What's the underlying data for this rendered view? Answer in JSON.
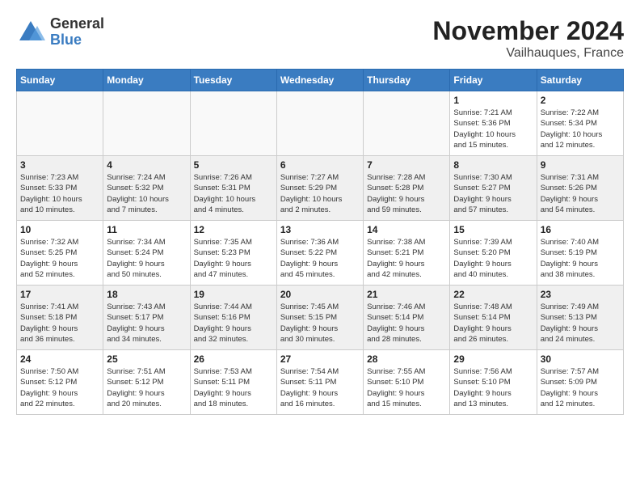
{
  "logo": {
    "general": "General",
    "blue": "Blue"
  },
  "title": "November 2024",
  "location": "Vailhauques, France",
  "headers": [
    "Sunday",
    "Monday",
    "Tuesday",
    "Wednesday",
    "Thursday",
    "Friday",
    "Saturday"
  ],
  "weeks": [
    [
      {
        "day": "",
        "info": ""
      },
      {
        "day": "",
        "info": ""
      },
      {
        "day": "",
        "info": ""
      },
      {
        "day": "",
        "info": ""
      },
      {
        "day": "",
        "info": ""
      },
      {
        "day": "1",
        "info": "Sunrise: 7:21 AM\nSunset: 5:36 PM\nDaylight: 10 hours\nand 15 minutes."
      },
      {
        "day": "2",
        "info": "Sunrise: 7:22 AM\nSunset: 5:34 PM\nDaylight: 10 hours\nand 12 minutes."
      }
    ],
    [
      {
        "day": "3",
        "info": "Sunrise: 7:23 AM\nSunset: 5:33 PM\nDaylight: 10 hours\nand 10 minutes."
      },
      {
        "day": "4",
        "info": "Sunrise: 7:24 AM\nSunset: 5:32 PM\nDaylight: 10 hours\nand 7 minutes."
      },
      {
        "day": "5",
        "info": "Sunrise: 7:26 AM\nSunset: 5:31 PM\nDaylight: 10 hours\nand 4 minutes."
      },
      {
        "day": "6",
        "info": "Sunrise: 7:27 AM\nSunset: 5:29 PM\nDaylight: 10 hours\nand 2 minutes."
      },
      {
        "day": "7",
        "info": "Sunrise: 7:28 AM\nSunset: 5:28 PM\nDaylight: 9 hours\nand 59 minutes."
      },
      {
        "day": "8",
        "info": "Sunrise: 7:30 AM\nSunset: 5:27 PM\nDaylight: 9 hours\nand 57 minutes."
      },
      {
        "day": "9",
        "info": "Sunrise: 7:31 AM\nSunset: 5:26 PM\nDaylight: 9 hours\nand 54 minutes."
      }
    ],
    [
      {
        "day": "10",
        "info": "Sunrise: 7:32 AM\nSunset: 5:25 PM\nDaylight: 9 hours\nand 52 minutes."
      },
      {
        "day": "11",
        "info": "Sunrise: 7:34 AM\nSunset: 5:24 PM\nDaylight: 9 hours\nand 50 minutes."
      },
      {
        "day": "12",
        "info": "Sunrise: 7:35 AM\nSunset: 5:23 PM\nDaylight: 9 hours\nand 47 minutes."
      },
      {
        "day": "13",
        "info": "Sunrise: 7:36 AM\nSunset: 5:22 PM\nDaylight: 9 hours\nand 45 minutes."
      },
      {
        "day": "14",
        "info": "Sunrise: 7:38 AM\nSunset: 5:21 PM\nDaylight: 9 hours\nand 42 minutes."
      },
      {
        "day": "15",
        "info": "Sunrise: 7:39 AM\nSunset: 5:20 PM\nDaylight: 9 hours\nand 40 minutes."
      },
      {
        "day": "16",
        "info": "Sunrise: 7:40 AM\nSunset: 5:19 PM\nDaylight: 9 hours\nand 38 minutes."
      }
    ],
    [
      {
        "day": "17",
        "info": "Sunrise: 7:41 AM\nSunset: 5:18 PM\nDaylight: 9 hours\nand 36 minutes."
      },
      {
        "day": "18",
        "info": "Sunrise: 7:43 AM\nSunset: 5:17 PM\nDaylight: 9 hours\nand 34 minutes."
      },
      {
        "day": "19",
        "info": "Sunrise: 7:44 AM\nSunset: 5:16 PM\nDaylight: 9 hours\nand 32 minutes."
      },
      {
        "day": "20",
        "info": "Sunrise: 7:45 AM\nSunset: 5:15 PM\nDaylight: 9 hours\nand 30 minutes."
      },
      {
        "day": "21",
        "info": "Sunrise: 7:46 AM\nSunset: 5:14 PM\nDaylight: 9 hours\nand 28 minutes."
      },
      {
        "day": "22",
        "info": "Sunrise: 7:48 AM\nSunset: 5:14 PM\nDaylight: 9 hours\nand 26 minutes."
      },
      {
        "day": "23",
        "info": "Sunrise: 7:49 AM\nSunset: 5:13 PM\nDaylight: 9 hours\nand 24 minutes."
      }
    ],
    [
      {
        "day": "24",
        "info": "Sunrise: 7:50 AM\nSunset: 5:12 PM\nDaylight: 9 hours\nand 22 minutes."
      },
      {
        "day": "25",
        "info": "Sunrise: 7:51 AM\nSunset: 5:12 PM\nDaylight: 9 hours\nand 20 minutes."
      },
      {
        "day": "26",
        "info": "Sunrise: 7:53 AM\nSunset: 5:11 PM\nDaylight: 9 hours\nand 18 minutes."
      },
      {
        "day": "27",
        "info": "Sunrise: 7:54 AM\nSunset: 5:11 PM\nDaylight: 9 hours\nand 16 minutes."
      },
      {
        "day": "28",
        "info": "Sunrise: 7:55 AM\nSunset: 5:10 PM\nDaylight: 9 hours\nand 15 minutes."
      },
      {
        "day": "29",
        "info": "Sunrise: 7:56 AM\nSunset: 5:10 PM\nDaylight: 9 hours\nand 13 minutes."
      },
      {
        "day": "30",
        "info": "Sunrise: 7:57 AM\nSunset: 5:09 PM\nDaylight: 9 hours\nand 12 minutes."
      }
    ]
  ]
}
